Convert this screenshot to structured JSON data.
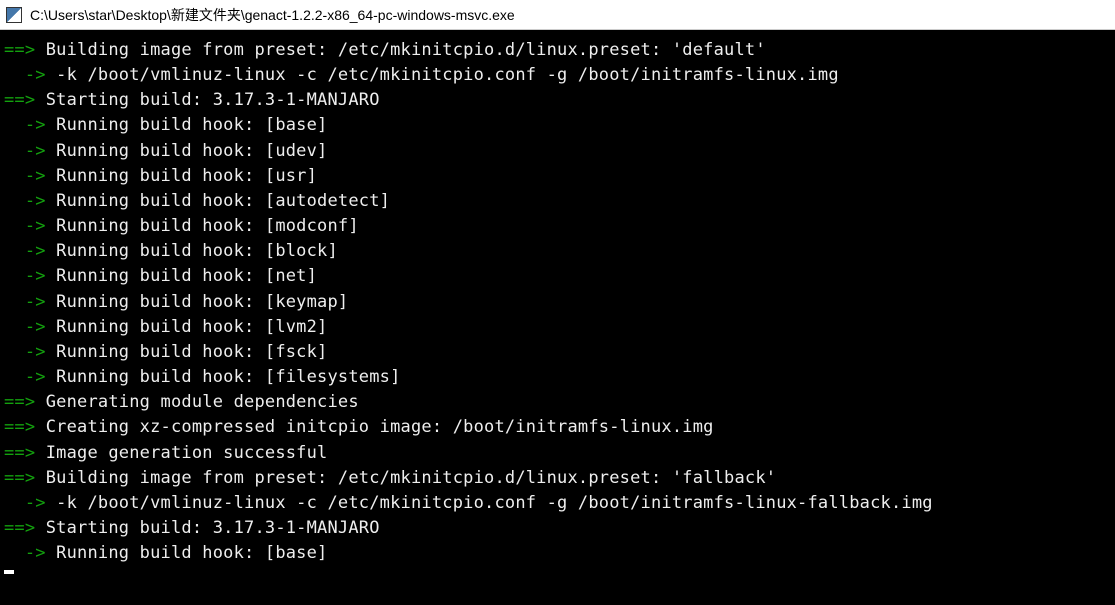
{
  "window": {
    "title": "C:\\Users\\star\\Desktop\\新建文件夹\\genact-1.2.2-x86_64-pc-windows-msvc.exe"
  },
  "terminal": {
    "lines": [
      {
        "prefix": "==>",
        "prefix_color": "green",
        "text": " Building image from preset: /etc/mkinitcpio.d/linux.preset: 'default'"
      },
      {
        "prefix": "  ->",
        "prefix_color": "green",
        "text": " -k /boot/vmlinuz-linux -c /etc/mkinitcpio.conf -g /boot/initramfs-linux.img"
      },
      {
        "prefix": "==>",
        "prefix_color": "green",
        "text": " Starting build: 3.17.3-1-MANJARO"
      },
      {
        "prefix": "  ->",
        "prefix_color": "green",
        "text": " Running build hook: [base]"
      },
      {
        "prefix": "  ->",
        "prefix_color": "green",
        "text": " Running build hook: [udev]"
      },
      {
        "prefix": "  ->",
        "prefix_color": "green",
        "text": " Running build hook: [usr]"
      },
      {
        "prefix": "  ->",
        "prefix_color": "green",
        "text": " Running build hook: [autodetect]"
      },
      {
        "prefix": "  ->",
        "prefix_color": "green",
        "text": " Running build hook: [modconf]"
      },
      {
        "prefix": "  ->",
        "prefix_color": "green",
        "text": " Running build hook: [block]"
      },
      {
        "prefix": "  ->",
        "prefix_color": "green",
        "text": " Running build hook: [net]"
      },
      {
        "prefix": "  ->",
        "prefix_color": "green",
        "text": " Running build hook: [keymap]"
      },
      {
        "prefix": "  ->",
        "prefix_color": "green",
        "text": " Running build hook: [lvm2]"
      },
      {
        "prefix": "  ->",
        "prefix_color": "green",
        "text": " Running build hook: [fsck]"
      },
      {
        "prefix": "  ->",
        "prefix_color": "green",
        "text": " Running build hook: [filesystems]"
      },
      {
        "prefix": "==>",
        "prefix_color": "green",
        "text": " Generating module dependencies"
      },
      {
        "prefix": "==>",
        "prefix_color": "green",
        "text": " Creating xz-compressed initcpio image: /boot/initramfs-linux.img"
      },
      {
        "prefix": "==>",
        "prefix_color": "green",
        "text": " Image generation successful"
      },
      {
        "prefix": "==>",
        "prefix_color": "green",
        "text": " Building image from preset: /etc/mkinitcpio.d/linux.preset: 'fallback'"
      },
      {
        "prefix": "  ->",
        "prefix_color": "green",
        "text": " -k /boot/vmlinuz-linux -c /etc/mkinitcpio.conf -g /boot/initramfs-linux-fallback.img"
      },
      {
        "prefix": "==>",
        "prefix_color": "green",
        "text": " Starting build: 3.17.3-1-MANJARO"
      },
      {
        "prefix": "  ->",
        "prefix_color": "green",
        "text": " Running build hook: [base]"
      }
    ]
  }
}
